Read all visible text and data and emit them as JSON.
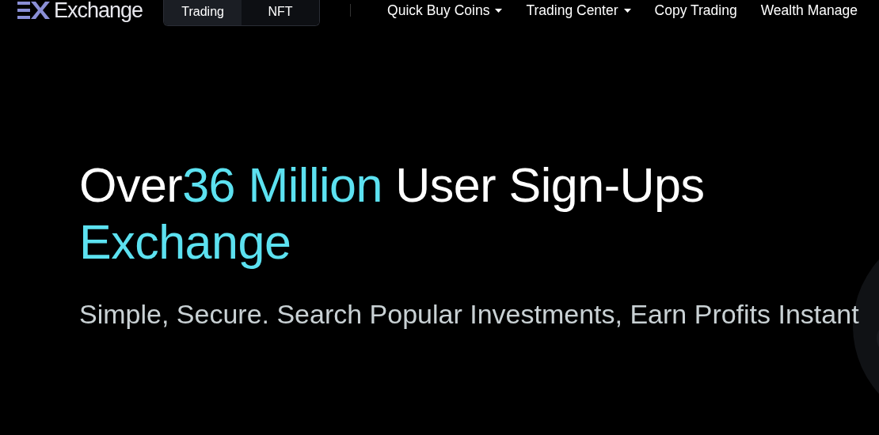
{
  "header": {
    "logo_text": "Exchange",
    "tabs": [
      {
        "label": "Trading",
        "selected": true
      },
      {
        "label": "NFT",
        "selected": false
      }
    ],
    "nav": [
      {
        "label": "Quick Buy Coins",
        "dropdown": true
      },
      {
        "label": "Trading Center",
        "dropdown": true
      },
      {
        "label": "Copy Trading",
        "dropdown": false
      },
      {
        "label": "Wealth Manage",
        "dropdown": false
      }
    ]
  },
  "hero": {
    "headline": [
      {
        "text": "Over",
        "accent": false
      },
      {
        "text": "36 Million",
        "accent": true
      },
      {
        "text": " User Sign-Ups",
        "accent": false
      }
    ],
    "subheadline": {
      "text": "Exchange",
      "accent": true
    },
    "tagline": "Simple, Secure. Search Popular Investments, Earn Profits Instant"
  }
}
